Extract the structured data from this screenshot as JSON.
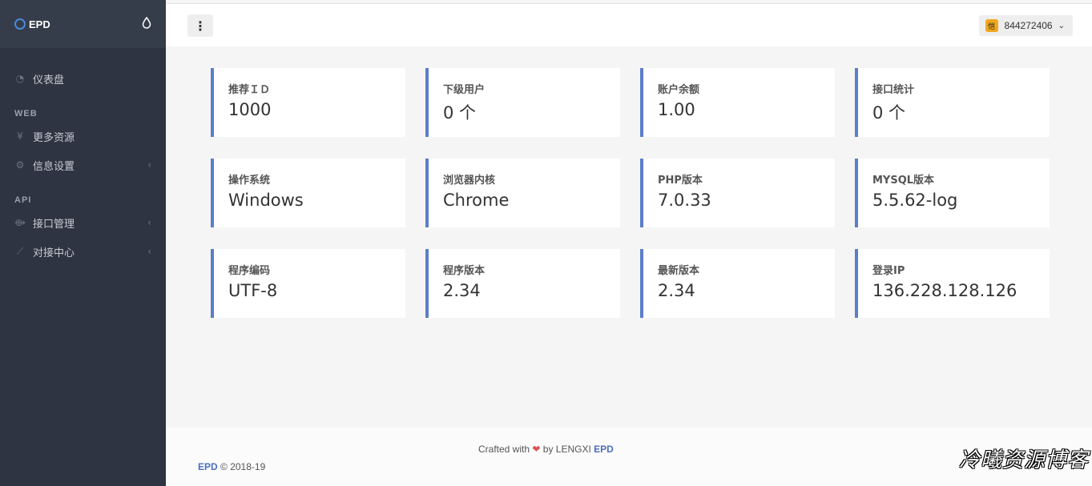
{
  "brand": {
    "name": "EPD",
    "theme_icon": "drop-icon"
  },
  "sidebar": {
    "items": [
      {
        "label": "仪表盘",
        "icon": "dashboard-icon"
      },
      {
        "section": "WEB"
      },
      {
        "label": "更多资源",
        "icon": "yen-icon"
      },
      {
        "label": "信息设置",
        "icon": "gear-icon",
        "has_children": true
      },
      {
        "section": "API"
      },
      {
        "label": "接口管理",
        "icon": "plug-icon",
        "has_children": true
      },
      {
        "label": "对接中心",
        "icon": "trend-icon",
        "has_children": true
      }
    ]
  },
  "header": {
    "menu_icon": "more-vertical-icon",
    "user": {
      "name": "844272406",
      "avatar_text": "恺"
    }
  },
  "cards": [
    {
      "label": "推荐ＩＤ",
      "value": "1000"
    },
    {
      "label": "下级用户",
      "value": "0 个"
    },
    {
      "label": "账户余额",
      "value": "1.00"
    },
    {
      "label": "接口统计",
      "value": "0 个"
    },
    {
      "label": "操作系统",
      "value": "Windows"
    },
    {
      "label": "浏览器内核",
      "value": "Chrome"
    },
    {
      "label": "PHP版本",
      "value": "7.0.33"
    },
    {
      "label": "MYSQL版本",
      "value": "5.5.62-log"
    },
    {
      "label": "程序编码",
      "value": "UTF-8"
    },
    {
      "label": "程序版本",
      "value": "2.34"
    },
    {
      "label": "最新版本",
      "value": "2.34"
    },
    {
      "label": "登录IP",
      "value": "136.228.128.126"
    }
  ],
  "footer": {
    "crafted": "Crafted with",
    "by": "by LENGXI",
    "brand_link": "EPD",
    "copy_link": "EPD",
    "copy_text": "© 2018-19",
    "watermark": "冷曦资源博客"
  },
  "colors": {
    "accent": "#5c7ec8",
    "sidebar": "#2e3441",
    "brand_bar": "#353c4a"
  }
}
